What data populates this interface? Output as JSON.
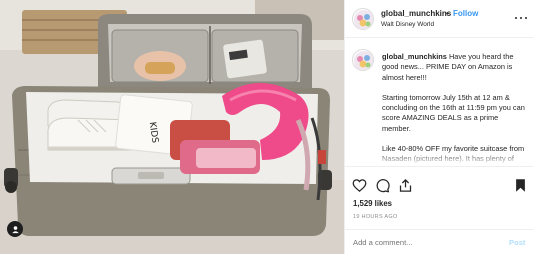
{
  "header": {
    "username": "global_munchkins",
    "separator": "•",
    "follow_label": "Follow",
    "location": "Walt Disney World"
  },
  "caption": {
    "username": "global_munchkins",
    "lines": [
      "Have you heard the good news... PRIME DAY on Amazon is almost here!!!",
      "Starting tomorrow July 15th at 12 am & concluding on the 16th at 11:59 pm you can score AMAZING DEALS as a prime member.",
      "Like 40-80% OFF my favorite suitcase from Nasaden (pictured here). It has plenty of room for all of my..."
    ]
  },
  "actions": {
    "likes": "1,529 likes",
    "time": "19 HOURS AGO"
  },
  "comment_box": {
    "placeholder": "Add a comment...",
    "post_label": "Post"
  },
  "photo": {
    "shoe_tag": "KIDS"
  },
  "colors": {
    "link_blue": "#3897f0",
    "post_disabled": "#b2dffc",
    "suitcase": "#8b8578",
    "pillow_pink": "#ef4a8a"
  },
  "icons": [
    "user-tag-icon",
    "more-options-icon",
    "heart-icon",
    "comment-icon",
    "share-icon",
    "bookmark-icon"
  ]
}
